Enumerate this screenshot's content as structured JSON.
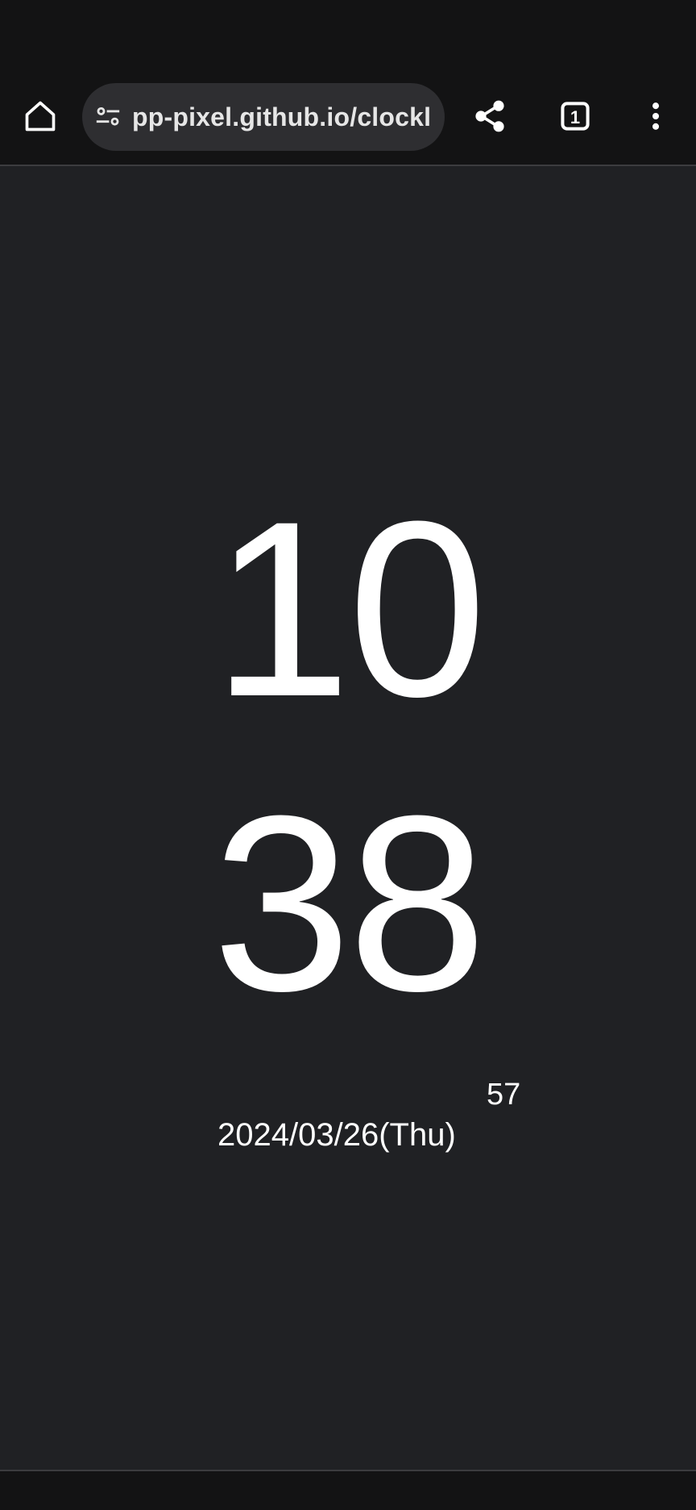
{
  "browser": {
    "url": "pp-pixel.github.io/clockl",
    "tab_count": "1",
    "icons": {
      "home": "home-icon",
      "site_settings": "tune-icon",
      "share": "share-icon",
      "tabs": "tab-switcher-icon",
      "menu": "more-vert-icon"
    }
  },
  "clock": {
    "hours": "10",
    "minutes": "38",
    "seconds": "57",
    "date": "2024/03/26(Thu)"
  },
  "colors": {
    "background": "#202124",
    "chrome": "#131314",
    "omnibox": "#2e2e31",
    "text": "#ffffff"
  }
}
